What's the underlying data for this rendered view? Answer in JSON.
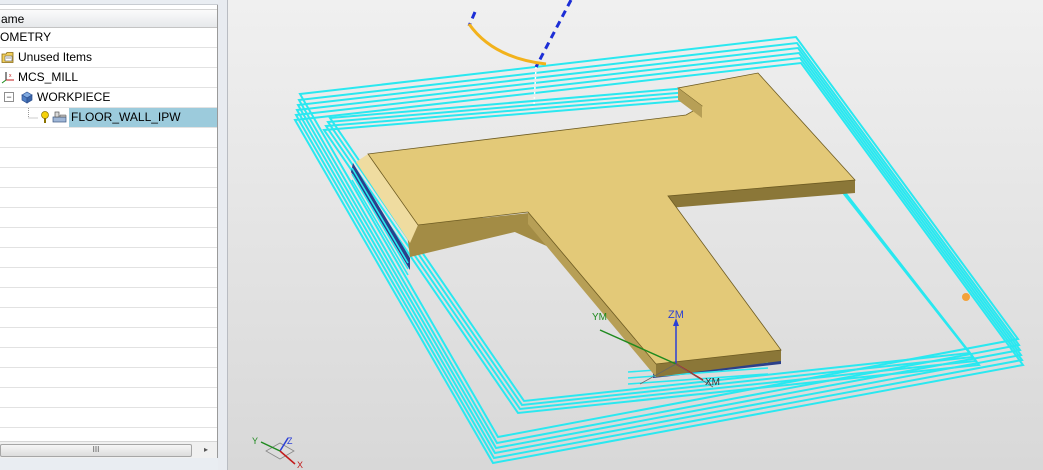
{
  "navigator": {
    "column_header": "ame",
    "rows": [
      {
        "label": "OMETRY"
      },
      {
        "label": "Unused Items"
      },
      {
        "label": "MCS_MILL"
      },
      {
        "label": "WORKPIECE"
      },
      {
        "label": "FLOOR_WALL_IPW"
      }
    ],
    "scroll_thumb_grip": "III",
    "scroll_right_arrow": "▸"
  },
  "viewport": {
    "axis_labels": {
      "zm": "ZM",
      "xm": "XM",
      "ym": "YM"
    },
    "triad": {
      "x": "X",
      "y": "Y",
      "z": "Z"
    },
    "colors": {
      "part_top": "#e3c978",
      "part_side": "#a38c45",
      "toolpath": "#2ae8f0",
      "tool_arc": "#f2b21c",
      "tool_axis": "#1c2ed6",
      "background": "#e6e6e6"
    }
  }
}
